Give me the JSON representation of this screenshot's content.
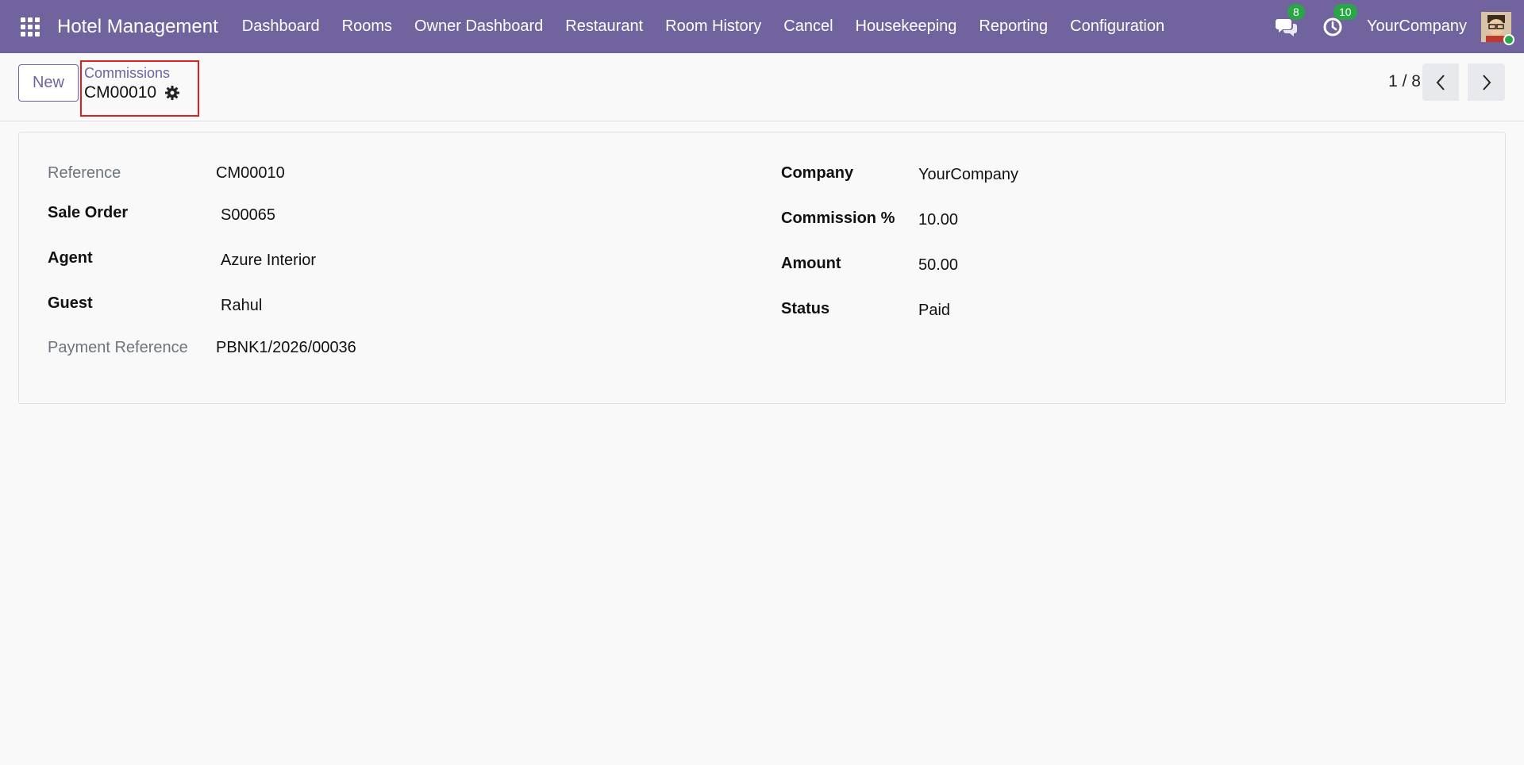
{
  "navbar": {
    "brand": "Hotel Management",
    "menu": [
      "Dashboard",
      "Rooms",
      "Owner Dashboard",
      "Restaurant",
      "Room History",
      "Cancel",
      "Housekeeping",
      "Reporting",
      "Configuration"
    ],
    "messages_count": "8",
    "activities_count": "10",
    "company": "YourCompany",
    "accent_color": "#71639e"
  },
  "control_panel": {
    "new_label": "New",
    "breadcrumb_parent": "Commissions",
    "breadcrumb_current": "CM00010",
    "pager": "1 / 8"
  },
  "form": {
    "left": [
      {
        "label": "Reference",
        "value": "CM00010"
      },
      {
        "label": "Sale Order",
        "value": "S00065"
      },
      {
        "label": "Agent",
        "value": "Azure Interior"
      },
      {
        "label": "Guest",
        "value": "Rahul"
      },
      {
        "label": "Payment Reference",
        "value": "PBNK1/2026/00036"
      }
    ],
    "right": [
      {
        "label": "Company",
        "value": "YourCompany"
      },
      {
        "label": "Commission %",
        "value": "10.00"
      },
      {
        "label": "Amount",
        "value": "50.00"
      },
      {
        "label": "Status",
        "value": "Paid"
      }
    ]
  }
}
